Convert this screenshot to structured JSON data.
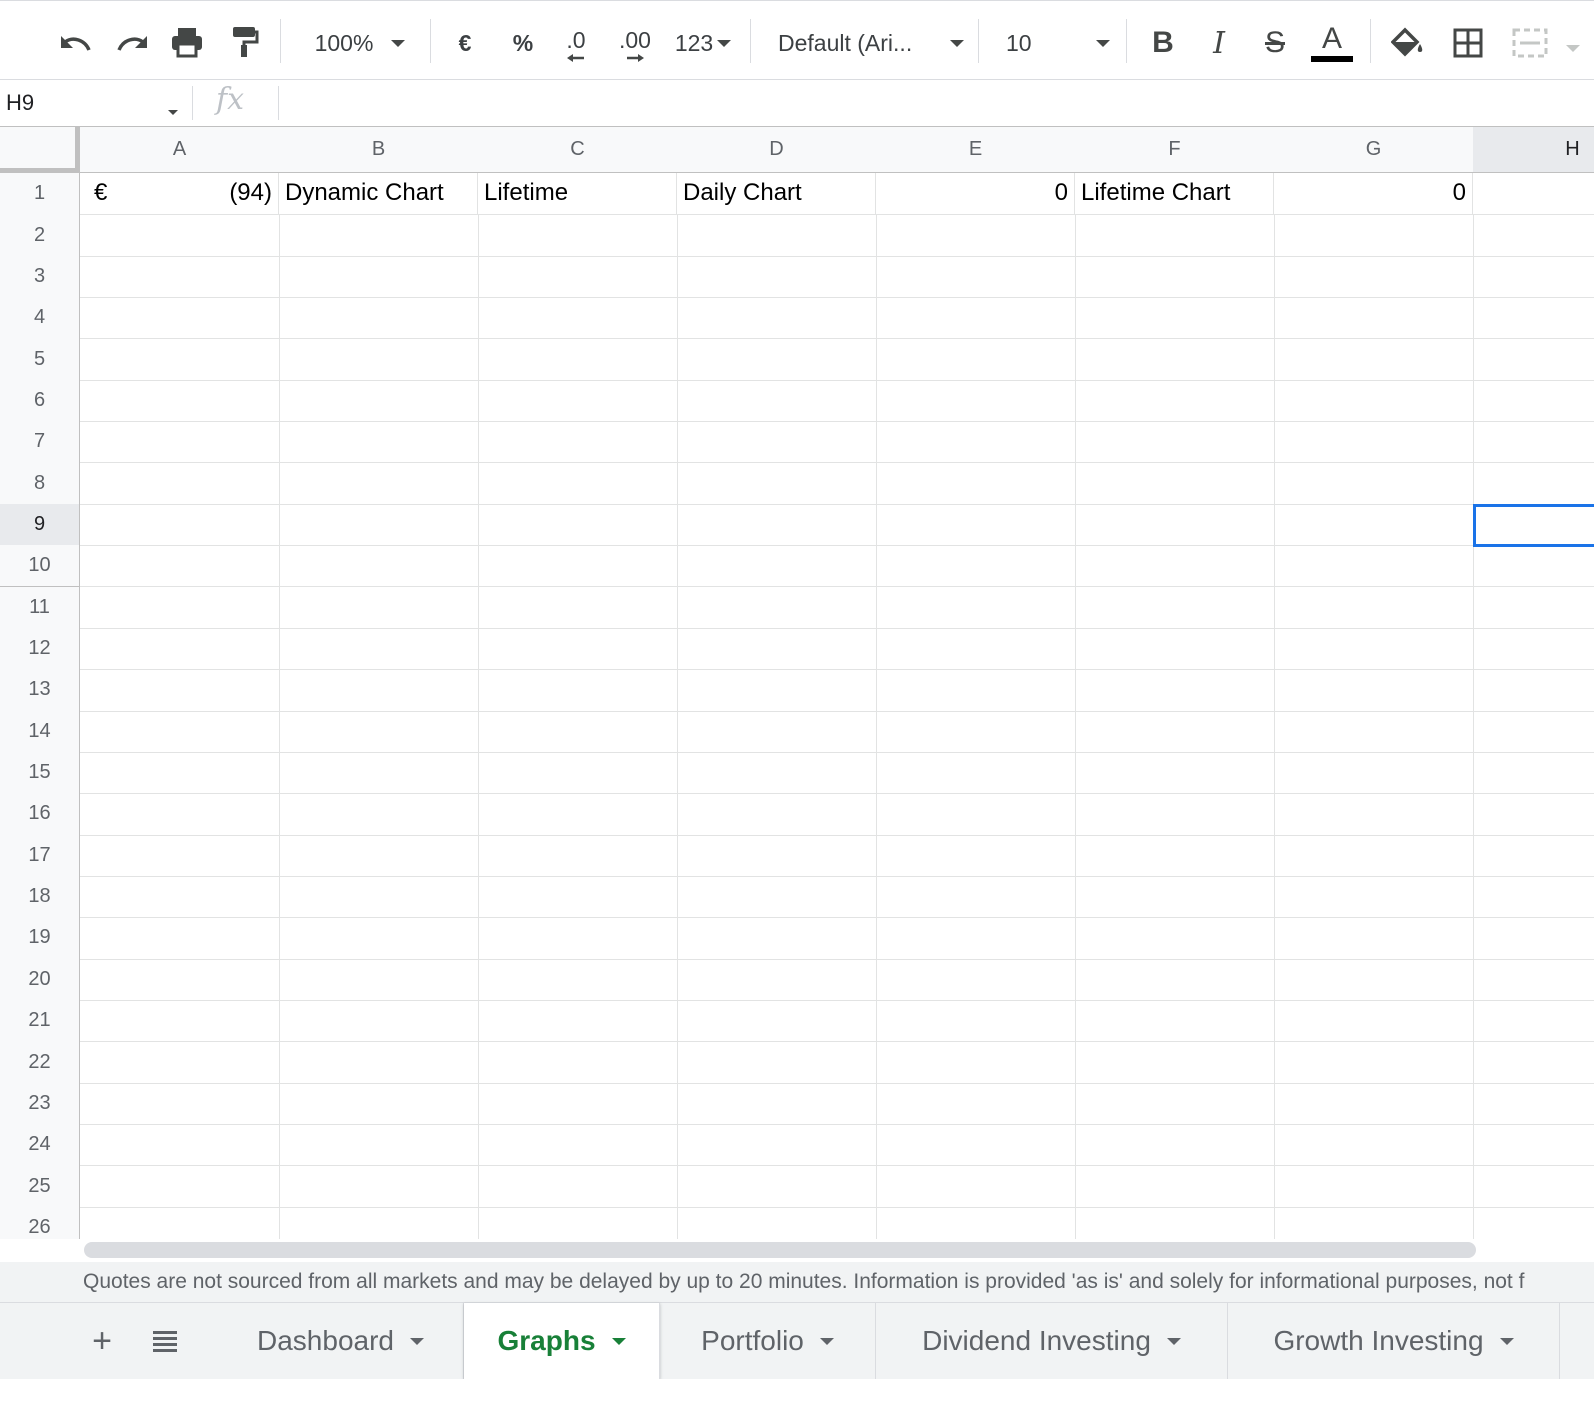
{
  "toolbar": {
    "zoom": "100%",
    "currency_symbol": "€",
    "percent_symbol": "%",
    "decrease_decimals": ".0",
    "increase_decimals": ".00",
    "more_formats": "123",
    "font_family": "Default (Ari...",
    "font_size": "10",
    "bold": "B",
    "italic": "I",
    "strikethrough": "S",
    "text_color_letter": "A",
    "text_color": "#000000",
    "icons": [
      "undo-icon",
      "redo-icon",
      "print-icon",
      "paint-format-icon",
      "fill-color-icon",
      "borders-icon",
      "merge-cells-icon"
    ]
  },
  "formula_bar": {
    "name_box": "H9",
    "fx": "fx",
    "formula": ""
  },
  "grid": {
    "columns": [
      "A",
      "B",
      "C",
      "D",
      "E",
      "F",
      "G",
      "H"
    ],
    "rows": [
      "1",
      "2",
      "3",
      "4",
      "5",
      "6",
      "7",
      "8",
      "9",
      "10",
      "11",
      "12",
      "13",
      "14",
      "15",
      "16",
      "17",
      "18",
      "19",
      "20",
      "21",
      "22",
      "23",
      "24",
      "25",
      "26"
    ],
    "selected_cell": "H9",
    "row1": {
      "A_symbol": "€",
      "A_value": "(94)",
      "B": "Dynamic Chart",
      "C": "Lifetime",
      "D": "Daily Chart",
      "E": "0",
      "F": "Lifetime Chart",
      "G": "0"
    },
    "selection_color": "#1a73e8"
  },
  "disclaimer": "Quotes are not sourced from all markets and may be delayed by up to 20 minutes. Information is provided 'as is' and solely for informational purposes, not f",
  "sheet_tabs": {
    "add_sheet": "+",
    "tabs": [
      {
        "label": "Dashboard",
        "active": false
      },
      {
        "label": "Graphs",
        "active": true
      },
      {
        "label": "Portfolio",
        "active": false
      },
      {
        "label": "Dividend Investing",
        "active": false
      },
      {
        "label": "Growth Investing",
        "active": false
      }
    ],
    "active_color": "#188038"
  }
}
